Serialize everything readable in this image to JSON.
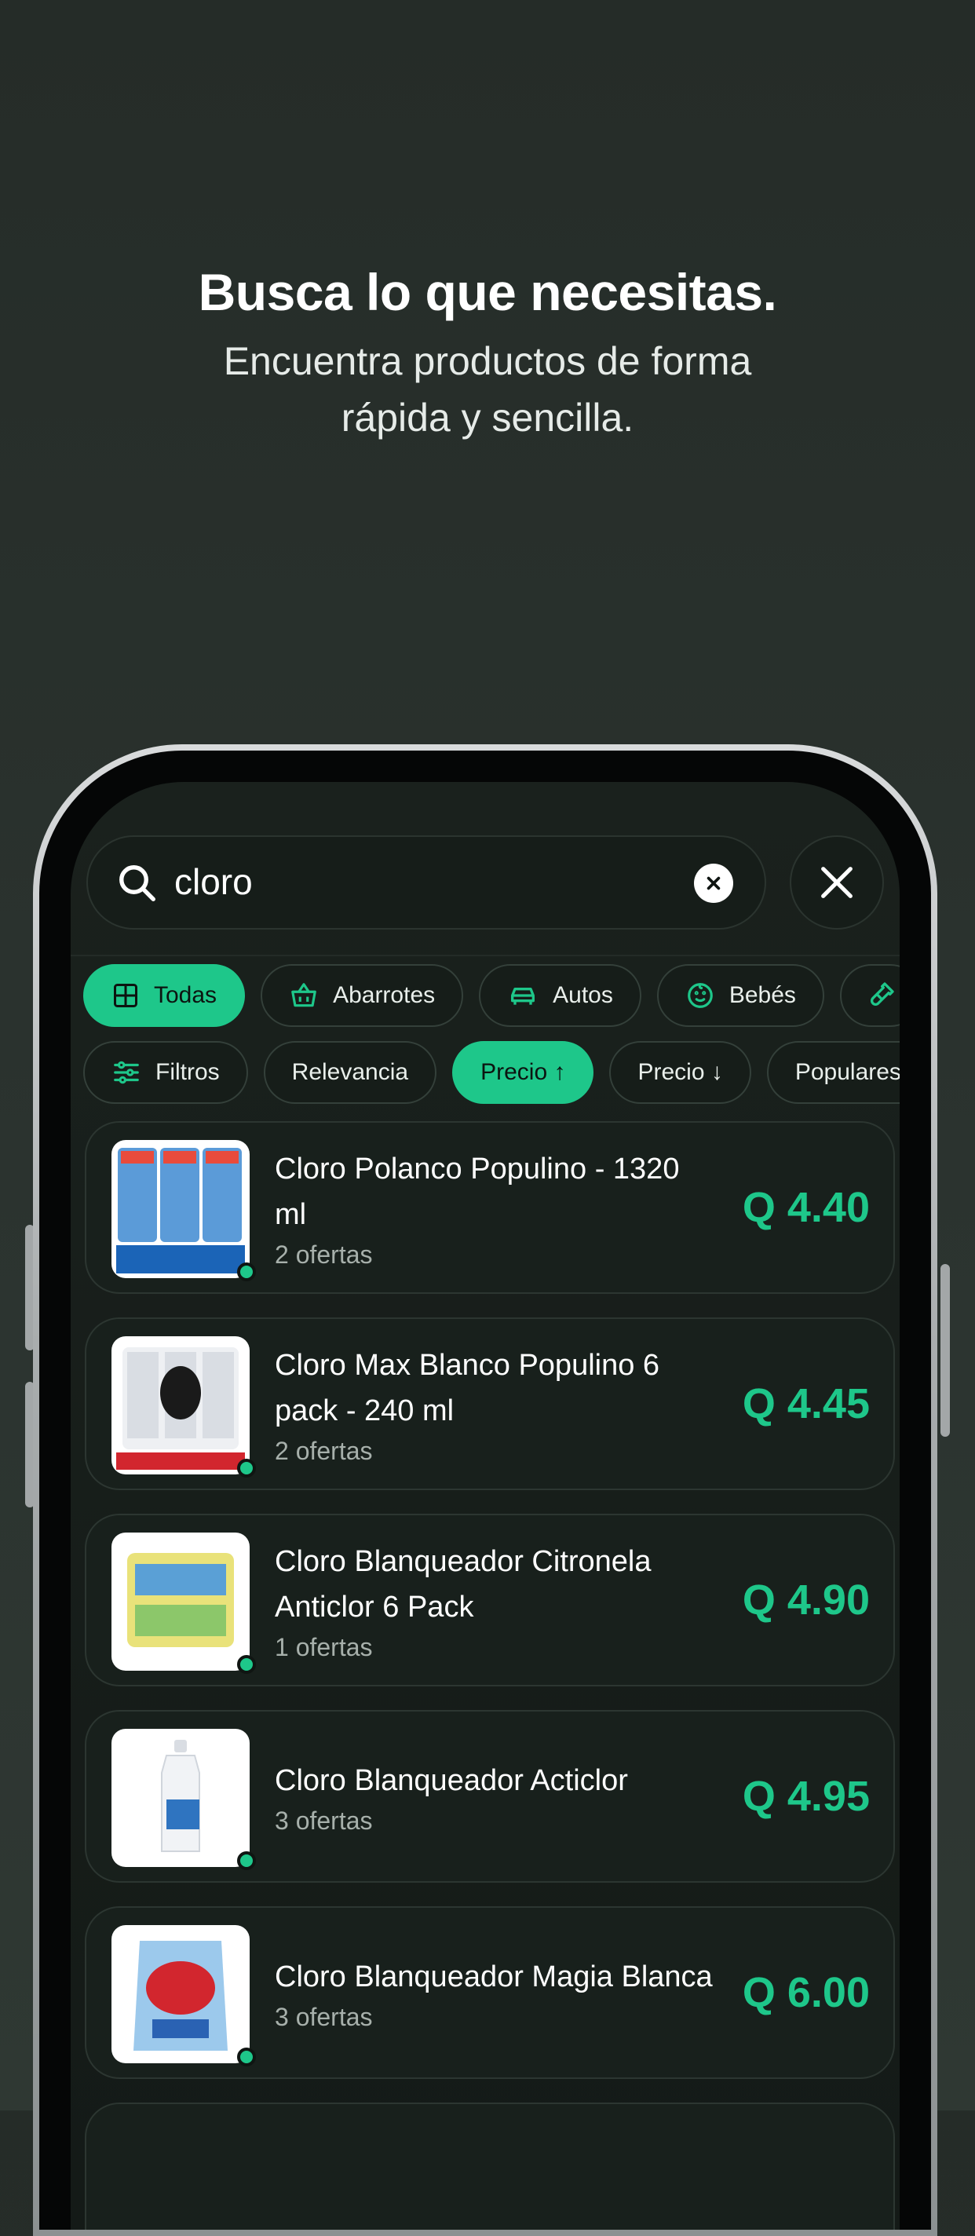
{
  "hero": {
    "title": "Busca lo que necesitas.",
    "subtitle_line1": "Encuentra productos de forma",
    "subtitle_line2": "rápida y sencilla."
  },
  "search": {
    "query": "cloro"
  },
  "categories": [
    {
      "label": "Todas",
      "icon": "grid-icon",
      "active": true
    },
    {
      "label": "Abarrotes",
      "icon": "basket-icon",
      "active": false
    },
    {
      "label": "Autos",
      "icon": "car-icon",
      "active": false
    },
    {
      "label": "Bebés",
      "icon": "baby-icon",
      "active": false
    },
    {
      "label": "",
      "icon": "bottle-icon",
      "active": false
    }
  ],
  "sorts": [
    {
      "label": "Filtros",
      "icon": "sliders-icon",
      "active": false
    },
    {
      "label": "Relevancia",
      "active": false
    },
    {
      "label": "Precio ↑",
      "active": true
    },
    {
      "label": "Precio ↓",
      "active": false
    },
    {
      "label": "Populares",
      "active": false
    }
  ],
  "products": [
    {
      "name": "Cloro Polanco Populino - 1320 ml",
      "offers": "2 ofertas",
      "price": "Q 4.40"
    },
    {
      "name": "Cloro Max Blanco Populino 6 pack - 240 ml",
      "offers": "2 ofertas",
      "price": "Q 4.45"
    },
    {
      "name": "Cloro Blanqueador Citronela Anticlor 6 Pack",
      "offers": "1 ofertas",
      "price": "Q 4.90"
    },
    {
      "name": "Cloro Blanqueador Acticlor",
      "offers": "3 ofertas",
      "price": "Q 4.95"
    },
    {
      "name": "Cloro Blanqueador Magia Blanca",
      "offers": "3 ofertas",
      "price": "Q 6.00"
    }
  ],
  "colors": {
    "accent": "#1ec78a",
    "background": "#2b332f"
  }
}
